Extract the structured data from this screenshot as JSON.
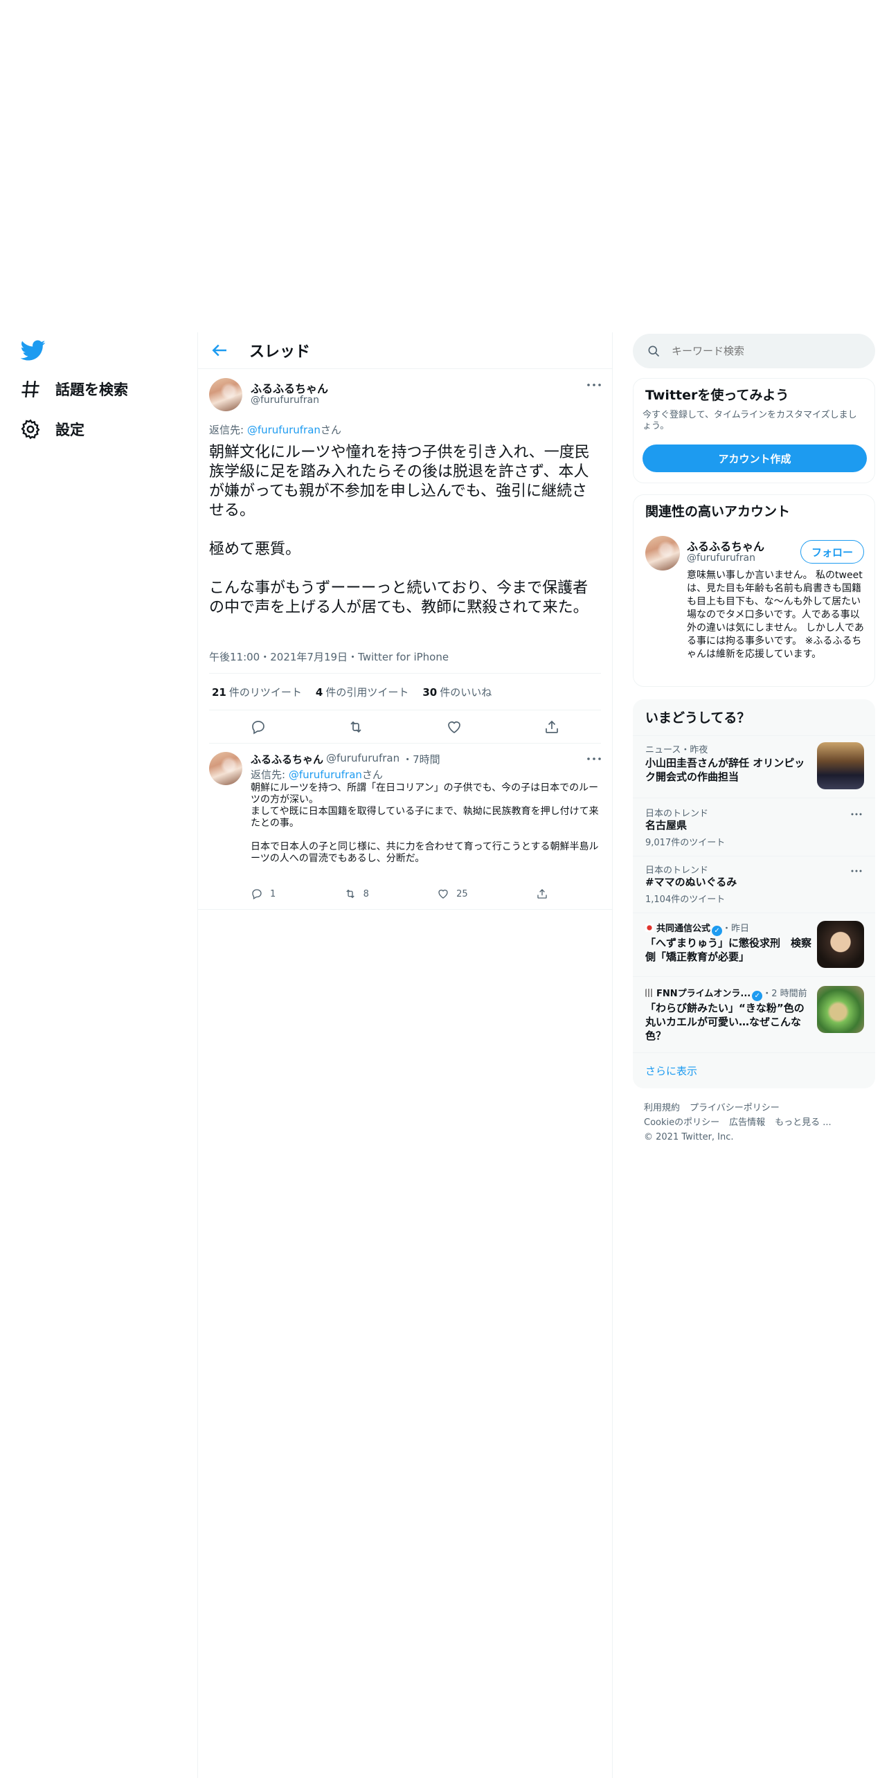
{
  "nav": {
    "items": [
      {
        "label": "話題を検索",
        "icon": "hashtag-icon"
      },
      {
        "label": "設定",
        "icon": "gear-icon"
      }
    ]
  },
  "thread": {
    "title": "スレッド",
    "main": {
      "name": "ふるふるちゃん",
      "handle": "@furufurufran",
      "reply_prefix": "返信先: ",
      "reply_to": "@furufurufran",
      "reply_suffix": "さん",
      "text": "朝鮮文化にルーツや憧れを持つ子供を引き入れ、一度民族学級に足を踏み入れたらその後は脱退を許さず、本人が嫌がっても親が不参加を申し込んでも、強引に継続させる。\n\n極めて悪質。\n\nこんな事がもうずーーーっと続いており、今まで保護者の中で声を上げる人が居ても、教師に黙殺されて来た。",
      "meta": "午後11:00・2021年7月19日・Twitter for iPhone",
      "stats": [
        {
          "count": "21",
          "label": "件のリツイート"
        },
        {
          "count": "4",
          "label": "件の引用ツイート"
        },
        {
          "count": "30",
          "label": "件のいいね"
        }
      ]
    },
    "reply": {
      "name": "ふるふるちゃん",
      "handle": "@furufurufran",
      "time": "・7時間",
      "reply_prefix": "返信先: ",
      "reply_to": "@furufurufran",
      "reply_suffix": "さん",
      "text": "朝鮮にルーツを持つ、所謂「在日コリアン」の子供でも、今の子は日本でのルーツの方が深い。\nましてや既に日本国籍を取得している子にまで、執拗に民族教育を押し付けて来たとの事。\n\n日本で日本人の子と同じ様に、共に力を合わせて育って行こうとする朝鮮半島ルーツの人への冒涜でもあるし、分断だ。",
      "replies": "1",
      "retweets": "8",
      "likes": "25"
    }
  },
  "search": {
    "placeholder": "キーワード検索"
  },
  "signup": {
    "title": "Twitterを使ってみよう",
    "desc": "今すぐ登録して、タイムラインをカスタマイズしましょう。",
    "button": "アカウント作成"
  },
  "related": {
    "title": "関連性の高いアカウント",
    "name": "ふるふるちゃん",
    "handle": "@furufurufran",
    "follow": "フォロー",
    "bio": "意味無い事しか言いません。 私のtweetは、見た目も年齢も名前も肩書きも国籍も目上も目下も、な〜んも外して居たい場なのでタメ口多いです。人である事以外の違いは気にしません。 しかし人である事には拘る事多いです。 ※ふるふるちゃんは維新を応援しています。"
  },
  "trends": {
    "title": "いまどうしてる？",
    "items": [
      {
        "context": "ニュース・昨夜",
        "title": "小山田圭吾さんが辞任 オリンピック開会式の作曲担当"
      },
      {
        "context": "日本のトレンド",
        "title": "名古屋県",
        "count": "9,017件のツイート"
      },
      {
        "context": "日本のトレンド",
        "title": "#ママのぬいぐるみ",
        "count": "1,104件のツイート"
      },
      {
        "source": "共同通信公式",
        "time": "・昨日",
        "title": "「へずまりゅう」に懲役求刑　検察側「矯正教育が必要」"
      },
      {
        "source": "FNNプライムオンラ...",
        "time": "・2 時間前",
        "title": "「わらび餅みたい」“きな粉”色の丸いカエルが可愛い…なぜこんな色？"
      }
    ],
    "show_more": "さらに表示"
  },
  "footer": {
    "terms": "利用規約",
    "privacy": "プライバシーポリシー",
    "cookie": "Cookieのポリシー",
    "ads": "広告情報",
    "more": "もっと見る ...",
    "copyright": "© 2021 Twitter, Inc."
  },
  "colors": {
    "accent": "#1d9bf0",
    "text": "#0f1419",
    "muted": "#536471",
    "border": "#eff3f4"
  }
}
